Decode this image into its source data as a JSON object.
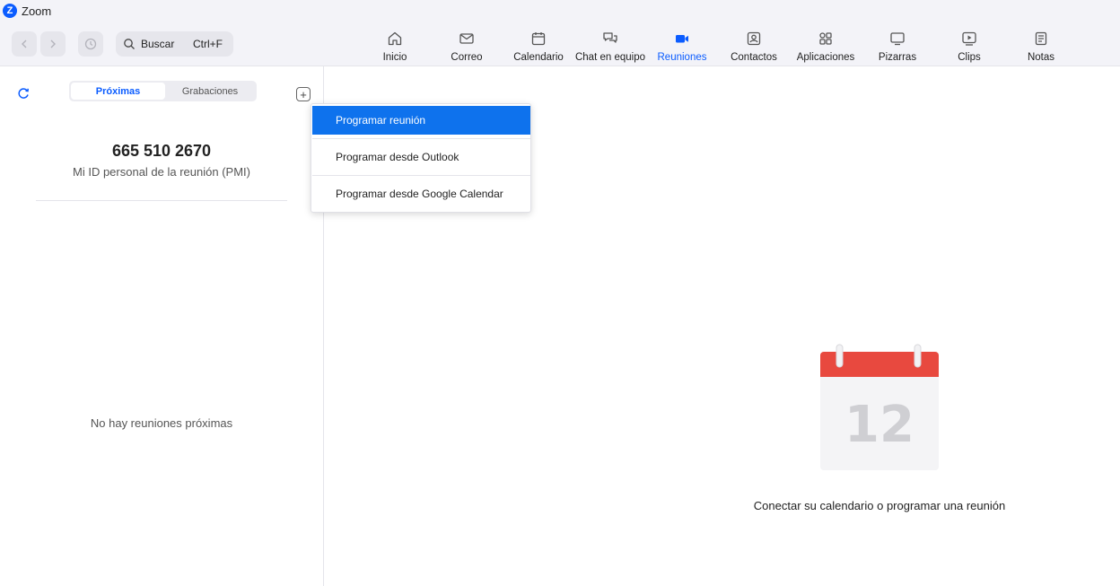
{
  "window": {
    "title": "Zoom"
  },
  "search": {
    "label": "Buscar",
    "shortcut": "Ctrl+F"
  },
  "nav": {
    "tabs": [
      {
        "label": "Inicio",
        "icon": "home-icon"
      },
      {
        "label": "Correo",
        "icon": "mail-icon"
      },
      {
        "label": "Calendario",
        "icon": "calendar-icon"
      },
      {
        "label": "Chat en equipo",
        "icon": "chat-icon"
      },
      {
        "label": "Reuniones",
        "icon": "video-camera-icon",
        "active": true
      },
      {
        "label": "Contactos",
        "icon": "contacts-icon"
      },
      {
        "label": "Aplicaciones",
        "icon": "apps-icon"
      },
      {
        "label": "Pizarras",
        "icon": "whiteboard-icon"
      },
      {
        "label": "Clips",
        "icon": "clips-icon"
      },
      {
        "label": "Notas",
        "icon": "notes-icon"
      }
    ]
  },
  "meetings": {
    "segments": {
      "upcoming": "Próximas",
      "recordings": "Grabaciones"
    },
    "pmi": {
      "number": "665 510 2670",
      "label": "Mi ID personal de la reunión (PMI)"
    },
    "empty_text": "No hay reuniones próximas"
  },
  "dropdown": {
    "items": [
      "Programar reunión",
      "Programar desde Outlook",
      "Programar desde Google Calendar"
    ]
  },
  "main": {
    "calendar_day": "12",
    "caption": "Conectar su calendario o programar una reunión"
  },
  "colors": {
    "accent": "#0b5cff",
    "menu_selected": "#0e72ed",
    "calendar_header": "#e8493f"
  }
}
